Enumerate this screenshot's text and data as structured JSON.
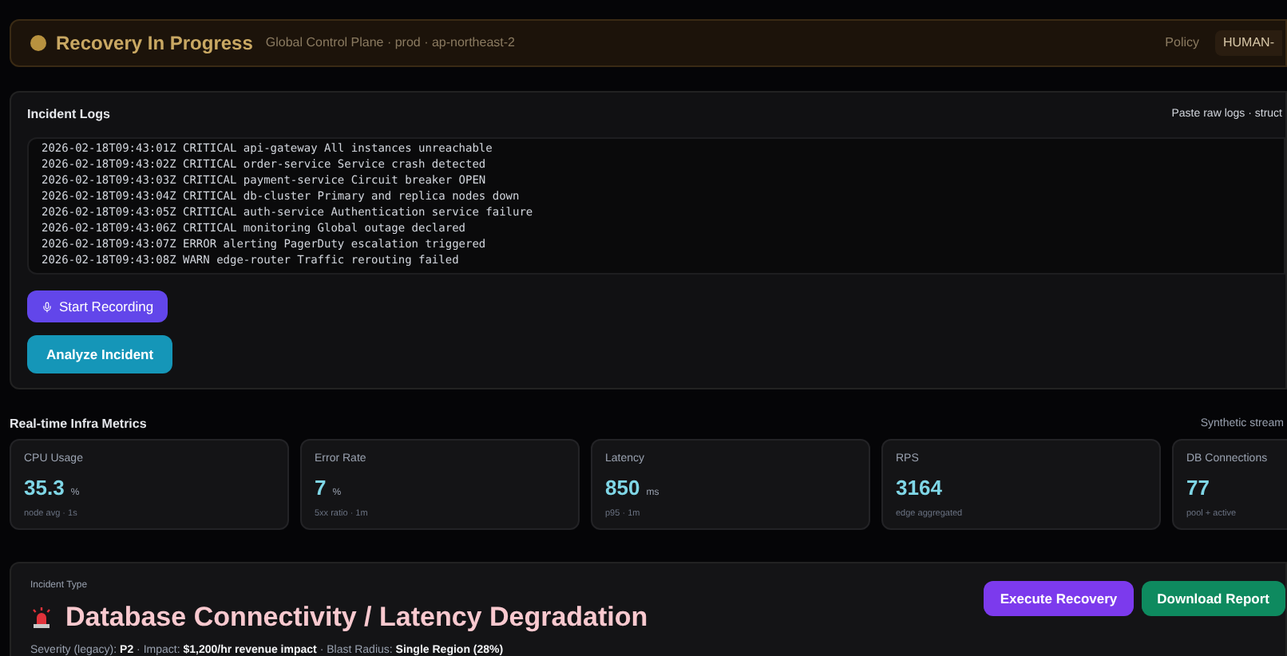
{
  "status_banner": {
    "title": "Recovery In Progress",
    "subtitle": "Global Control Plane · prod · ap-northeast-2",
    "policy_label": "Policy",
    "policy_badge": "HUMAN-"
  },
  "incident_logs": {
    "title": "Incident Logs",
    "hint": "Paste raw logs · struct",
    "lines": [
      "2026-02-18T09:43:01Z CRITICAL api-gateway All instances unreachable",
      "2026-02-18T09:43:02Z CRITICAL order-service Service crash detected",
      "2026-02-18T09:43:03Z CRITICAL payment-service Circuit breaker OPEN",
      "2026-02-18T09:43:04Z CRITICAL db-cluster Primary and replica nodes down",
      "2026-02-18T09:43:05Z CRITICAL auth-service Authentication service failure",
      "2026-02-18T09:43:06Z CRITICAL monitoring Global outage declared",
      "2026-02-18T09:43:07Z ERROR alerting PagerDuty escalation triggered",
      "2026-02-18T09:43:08Z WARN edge-router Traffic rerouting failed"
    ],
    "record_button": "Start Recording",
    "analyze_button": "Analyze Incident"
  },
  "metrics": {
    "title": "Real-time Infra Metrics",
    "note": "Synthetic stream",
    "cards": [
      {
        "label": "CPU Usage",
        "value": "35.3",
        "unit": "%",
        "caption": "node avg · 1s"
      },
      {
        "label": "Error Rate",
        "value": "7",
        "unit": "%",
        "caption": "5xx ratio · 1m"
      },
      {
        "label": "Latency",
        "value": "850",
        "unit": "ms",
        "caption": "p95 · 1m"
      },
      {
        "label": "RPS",
        "value": "3164",
        "caption": "edge aggregated"
      },
      {
        "label": "DB Connections",
        "value": "77",
        "caption": "pool + active"
      }
    ]
  },
  "incident": {
    "label": "Incident Type",
    "title": "Database Connectivity / Latency Degradation",
    "details": "Severity (legacy): **P2** · Impact: **$1,200/hr revenue impact** · Blast Radius: **Single Region (28%)**",
    "buttons": [
      {
        "label": "Execute Recovery",
        "kind": "primary"
      },
      {
        "label": "Download Report",
        "kind": "success"
      }
    ]
  }
}
